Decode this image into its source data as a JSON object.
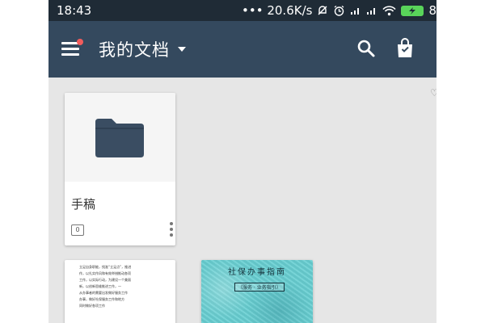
{
  "status_bar": {
    "time": "18:43",
    "network_speed": "••• 20.6K/s",
    "icons": [
      "silent-bell-icon",
      "alarm-icon",
      "signal-icon",
      "signal-icon",
      "wifi-icon",
      "battery-charging-icon"
    ],
    "battery_text": "8"
  },
  "app_bar": {
    "title": "我的文档",
    "menu_has_notification": true,
    "icons": [
      "hamburger-menu-icon",
      "dropdown-caret-icon",
      "search-icon",
      "shopping-bag-icon"
    ],
    "color": "#34495e"
  },
  "documents": [
    {
      "type": "folder",
      "name": "手稿",
      "count": "0",
      "icon": "folder-icon"
    },
    {
      "type": "document",
      "preview_lines": [
        "立足自身职能，找准“立足点”，推进",
        "作，以扎实作风和有效举措推动各项",
        "工作，以实际行动，为建设一个美丽",
        "新，以创新思维推进工作，一",
        "从办事者的需要出发做好服务工作",
        "办事，做好社保服务工作和地方",
        "同时做好各项工作"
      ]
    },
    {
      "type": "cover",
      "cover_title": "社保办事指南",
      "cover_subtitle": "（服务 · 业务指引）"
    }
  ],
  "colors": {
    "status_bar": "#1f2b36",
    "background": "#e6e6e6",
    "folder": "#3a4d62",
    "cover": "#68cfd2",
    "notification_dot": "#f25c5c",
    "battery": "#59d45a"
  }
}
